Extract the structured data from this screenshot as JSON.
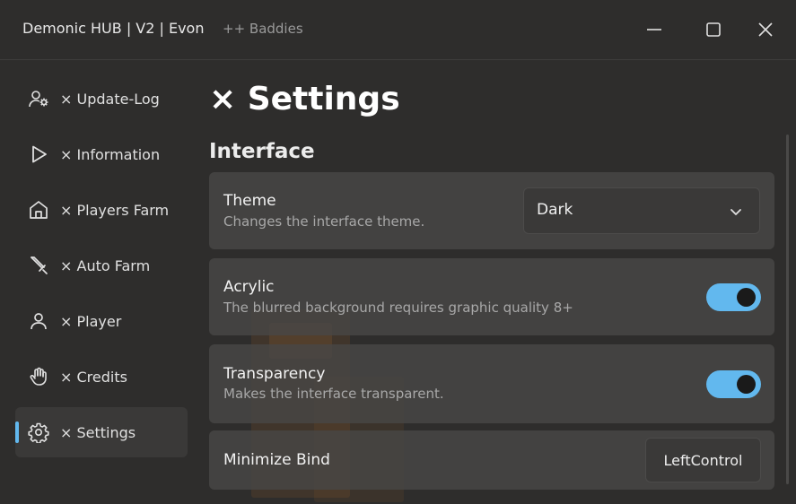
{
  "window": {
    "title": "Demonic HUB | V2 | Evon",
    "subtitle": "++ Baddies",
    "controls": [
      "minimize-icon",
      "maximize-icon",
      "close-icon"
    ]
  },
  "sidebar": {
    "items": [
      {
        "label": "× Update-Log",
        "icon": "user-gear-icon",
        "active": false
      },
      {
        "label": "× Information",
        "icon": "play-icon",
        "active": false
      },
      {
        "label": "× Players Farm",
        "icon": "home-icon",
        "active": false
      },
      {
        "label": "× Auto Farm",
        "icon": "sword-icon",
        "active": false
      },
      {
        "label": "× Player",
        "icon": "user-icon",
        "active": false
      },
      {
        "label": "× Credits",
        "icon": "hand-icon",
        "active": false
      },
      {
        "label": "× Settings",
        "icon": "gear-icon",
        "active": true
      }
    ]
  },
  "main": {
    "title": "× Settings",
    "section": "Interface",
    "settings": {
      "theme": {
        "title": "Theme",
        "description": "Changes the interface theme.",
        "value": "Dark"
      },
      "acrylic": {
        "title": "Acrylic",
        "description": "The blurred background requires graphic quality 8+",
        "enabled": true
      },
      "transparency": {
        "title": "Transparency",
        "description": "Makes the interface transparent.",
        "enabled": true
      },
      "minimize_bind": {
        "title": "Minimize Bind",
        "value": "LeftControl"
      }
    }
  },
  "colors": {
    "accent": "#62b8ee",
    "background": "#2e2d2c",
    "panel": "#484746"
  }
}
